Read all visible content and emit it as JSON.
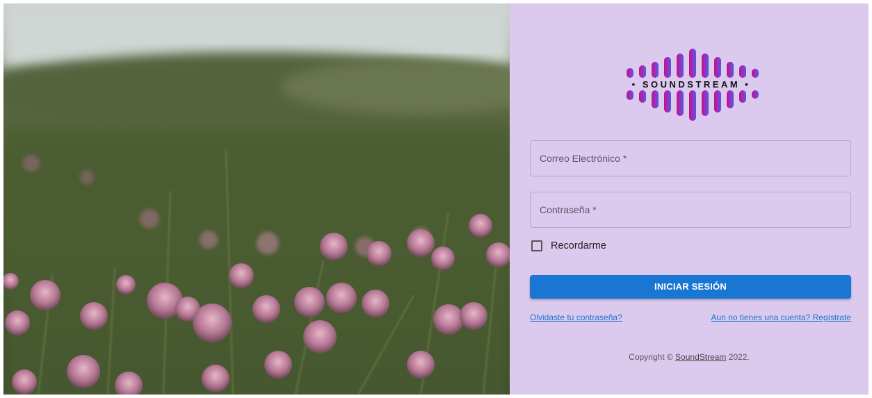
{
  "logo": {
    "brand_text": "• SOUNDSTREAM •"
  },
  "login_form": {
    "email_label": "Correo Electrónico *",
    "password_label": "Contraseña *",
    "remember_label": "Recordarme",
    "remember_checked": false,
    "submit_label": "INICIAR SESIÓN",
    "forgot_link": "Olvidaste tu contraseña?",
    "register_link": "Aun no tienes una cuenta? Regístrate"
  },
  "footer": {
    "prefix": "Copyright © ",
    "brand": "SoundStream",
    "suffix": " 2022."
  },
  "colors": {
    "panel_bg": "#dcc9ee",
    "primary": "#1976d2",
    "logo_magenta": "#c0147a",
    "logo_purple": "#7a3ad6",
    "logo_blue": "#4a5fd8"
  }
}
